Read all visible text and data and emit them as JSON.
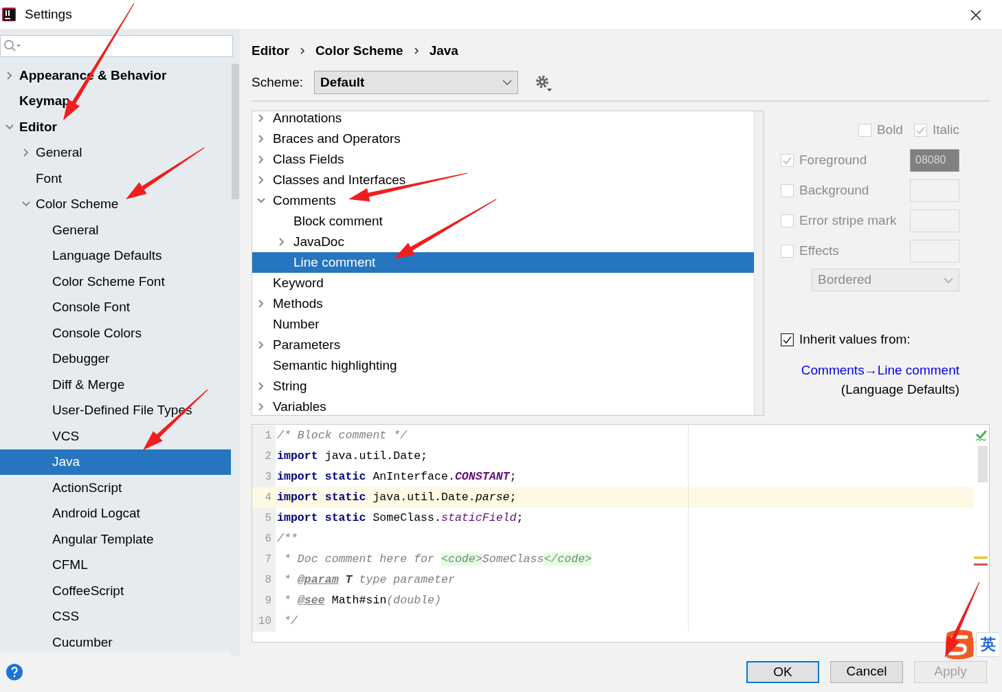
{
  "window": {
    "title": "Settings"
  },
  "sidebar": {
    "items": [
      {
        "label": "Appearance & Behavior",
        "expanded": false,
        "selected": false
      },
      {
        "label": "Keymap",
        "selected": false
      },
      {
        "label": "Editor",
        "expanded": true,
        "selected": false,
        "children": [
          {
            "label": "General",
            "expanded": false,
            "selected": false
          },
          {
            "label": "Font",
            "selected": false
          },
          {
            "label": "Color Scheme",
            "expanded": true,
            "selected": false,
            "children": [
              {
                "label": "General",
                "selected": false
              },
              {
                "label": "Language Defaults",
                "selected": false
              },
              {
                "label": "Color Scheme Font",
                "selected": false
              },
              {
                "label": "Console Font",
                "selected": false
              },
              {
                "label": "Console Colors",
                "selected": false
              },
              {
                "label": "Debugger",
                "selected": false
              },
              {
                "label": "Diff & Merge",
                "selected": false
              },
              {
                "label": "User-Defined File Types",
                "selected": false
              },
              {
                "label": "VCS",
                "selected": false
              },
              {
                "label": "Java",
                "selected": true
              },
              {
                "label": "ActionScript",
                "selected": false
              },
              {
                "label": "Android Logcat",
                "selected": false
              },
              {
                "label": "Angular Template",
                "selected": false
              },
              {
                "label": "CFML",
                "selected": false
              },
              {
                "label": "CoffeeScript",
                "selected": false
              },
              {
                "label": "CSS",
                "selected": false
              },
              {
                "label": "Cucumber",
                "selected": false
              }
            ]
          }
        ]
      }
    ]
  },
  "breadcrumb": [
    "Editor",
    "Color Scheme",
    "Java"
  ],
  "scheme": {
    "label": "Scheme:",
    "value": "Default"
  },
  "element_tree": {
    "items": [
      {
        "label": "Annotations",
        "expanded": false,
        "selected": false
      },
      {
        "label": "Braces and Operators",
        "expanded": false,
        "selected": false
      },
      {
        "label": "Class Fields",
        "expanded": false,
        "selected": false
      },
      {
        "label": "Classes and Interfaces",
        "expanded": false,
        "selected": false
      },
      {
        "label": "Comments",
        "expanded": true,
        "selected": false,
        "children": [
          {
            "label": "Block comment",
            "selected": false
          },
          {
            "label": "JavaDoc",
            "expanded": false,
            "selected": false
          },
          {
            "label": "Line comment",
            "selected": true
          }
        ]
      },
      {
        "label": "Keyword",
        "selected": false
      },
      {
        "label": "Methods",
        "expanded": false,
        "selected": false
      },
      {
        "label": "Number",
        "selected": false
      },
      {
        "label": "Parameters",
        "expanded": false,
        "selected": false
      },
      {
        "label": "Semantic highlighting",
        "selected": false
      },
      {
        "label": "String",
        "expanded": false,
        "selected": false
      },
      {
        "label": "Variables",
        "expanded": false,
        "selected": false
      }
    ]
  },
  "attributes": {
    "disabled": true,
    "styles": [
      {
        "label": "Bold",
        "checked": false
      },
      {
        "label": "Italic",
        "checked": true
      }
    ],
    "colors": [
      {
        "label": "Foreground",
        "checked": true,
        "value": "08080"
      },
      {
        "label": "Background",
        "checked": false
      },
      {
        "label": "Error stripe mark",
        "checked": false
      },
      {
        "label": "Effects",
        "checked": false
      }
    ],
    "effect_type": "Bordered",
    "inherit": {
      "label": "Inherit values from:",
      "checked": true,
      "link": "Comments→Line comment",
      "source": "(Language Defaults)"
    }
  },
  "preview": {
    "lines": [
      {
        "number": "1",
        "current": false,
        "tokens": [
          {
            "kind": "comment",
            "text": "/* Block comment */"
          }
        ]
      },
      {
        "number": "2",
        "current": false,
        "tokens": [
          {
            "kind": "keyword",
            "text": "import"
          },
          {
            "kind": "plain",
            "text": " java.util.Date;"
          }
        ]
      },
      {
        "number": "3",
        "current": false,
        "tokens": [
          {
            "kind": "keyword",
            "text": "import static"
          },
          {
            "kind": "plain",
            "text": " AnInterface."
          },
          {
            "kind": "constant",
            "text": "CONSTANT"
          },
          {
            "kind": "plain",
            "text": ";"
          }
        ]
      },
      {
        "number": "4",
        "current": true,
        "tokens": [
          {
            "kind": "keyword",
            "text": "import static"
          },
          {
            "kind": "plain",
            "text": " java.util.Date."
          },
          {
            "kind": "static-method",
            "text": "parse"
          },
          {
            "kind": "plain",
            "text": ";"
          }
        ]
      },
      {
        "number": "5",
        "current": false,
        "tokens": [
          {
            "kind": "keyword",
            "text": "import static"
          },
          {
            "kind": "plain",
            "text": " SomeClass."
          },
          {
            "kind": "static-field",
            "text": "staticField"
          },
          {
            "kind": "plain",
            "text": ";"
          }
        ]
      },
      {
        "number": "6",
        "current": false,
        "tokens": [
          {
            "kind": "comment",
            "text": "/**"
          }
        ]
      },
      {
        "number": "7",
        "current": false,
        "tokens": [
          {
            "kind": "comment",
            "text": " * Doc comment here for "
          },
          {
            "kind": "markup",
            "text": "<code>"
          },
          {
            "kind": "comment",
            "text": "SomeClass"
          },
          {
            "kind": "markup",
            "text": "</code>"
          }
        ]
      },
      {
        "number": "8",
        "current": false,
        "tokens": [
          {
            "kind": "comment",
            "text": " * "
          },
          {
            "kind": "doc-tag",
            "text": "@param"
          },
          {
            "kind": "doc-value",
            "text": " T"
          },
          {
            "kind": "comment",
            "text": " type parameter"
          }
        ]
      },
      {
        "number": "9",
        "current": false,
        "tokens": [
          {
            "kind": "comment",
            "text": " * "
          },
          {
            "kind": "doc-tag",
            "text": "@see"
          },
          {
            "kind": "plain",
            "text": " Math#sin"
          },
          {
            "kind": "comment",
            "text": "(double)"
          }
        ]
      },
      {
        "number": "10",
        "current": false,
        "tokens": [
          {
            "kind": "comment",
            "text": " */"
          }
        ]
      }
    ]
  },
  "buttons": [
    {
      "label": "OK",
      "default": true,
      "disabled": false
    },
    {
      "label": "Cancel",
      "default": false,
      "disabled": false
    },
    {
      "label": "Apply",
      "default": false,
      "disabled": true
    }
  ],
  "ime_indicator": {
    "label": "英"
  }
}
